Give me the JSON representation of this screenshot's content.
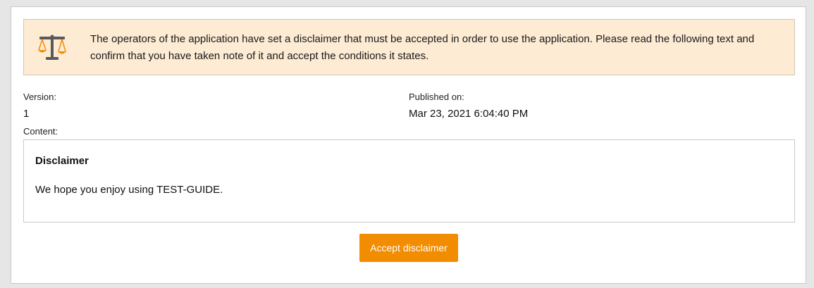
{
  "notice": {
    "icon": "scales-of-justice-icon",
    "text": "The operators of the application have set a disclaimer that must be accepted in order to use the application. Please read the following text and confirm that you have taken note of it and accept the conditions it states.",
    "background_color": "#fdebd3",
    "icon_accent_color": "#f28c00"
  },
  "meta": {
    "version_label": "Version:",
    "version_value": "1",
    "published_label": "Published on:",
    "published_value": "Mar 23, 2021 6:04:40 PM",
    "content_label": "Content:"
  },
  "content": {
    "title": "Disclaimer",
    "body": "We hope you enjoy using TEST-GUIDE."
  },
  "actions": {
    "accept_label": "Accept disclaimer",
    "accept_color": "#f28c00"
  }
}
